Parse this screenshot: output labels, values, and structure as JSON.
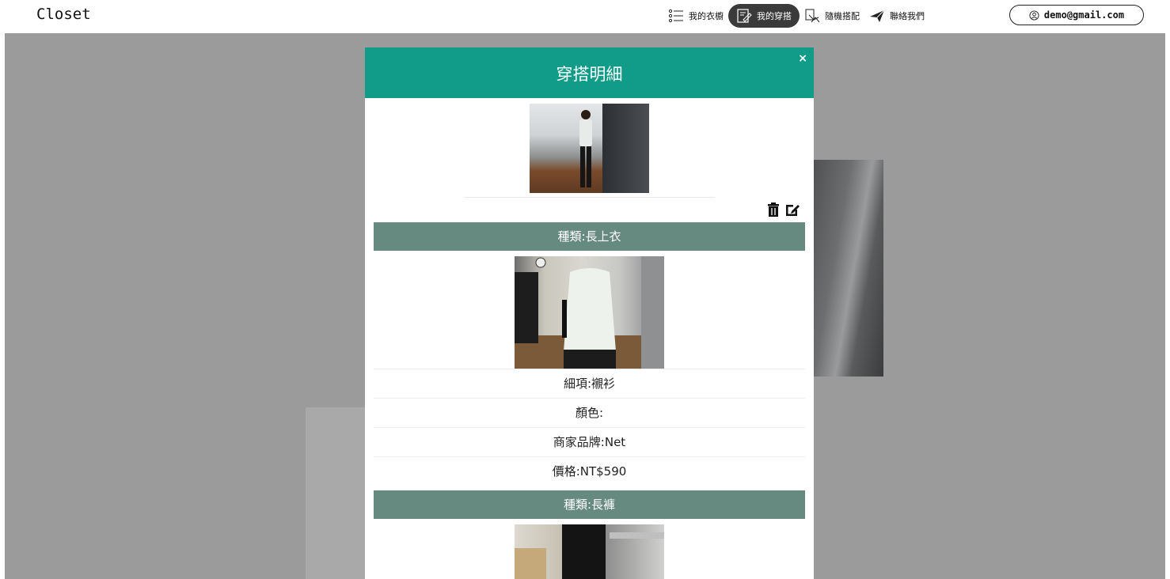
{
  "app": {
    "logo": "Closet"
  },
  "nav": {
    "items": [
      {
        "label": "我的衣櫥",
        "icon": "list-icon",
        "active": false
      },
      {
        "label": "我的穿搭",
        "icon": "edit-note-icon",
        "active": true
      },
      {
        "label": "隨機搭配",
        "icon": "shuffle-hanger-icon",
        "active": false
      },
      {
        "label": "聯絡我們",
        "icon": "paper-plane-icon",
        "active": false
      }
    ]
  },
  "user": {
    "email": "demo@gmail.com",
    "icon": "user-circle-icon"
  },
  "modal": {
    "title": "穿搭明細",
    "close_label": "×",
    "actions": {
      "delete_icon": "trash-icon",
      "edit_icon": "edit-icon"
    },
    "items": [
      {
        "category": "種類:長上衣",
        "detail": "細項:襯衫",
        "color": "顏色:",
        "brand": "商家品牌:Net",
        "price": "價格:NT$590"
      },
      {
        "category": "種類:長褲"
      }
    ]
  },
  "colors": {
    "header": "#119c8a",
    "section": "#678a80",
    "backdrop": "#9b9b9b",
    "active_nav": "#3a3a3a"
  }
}
